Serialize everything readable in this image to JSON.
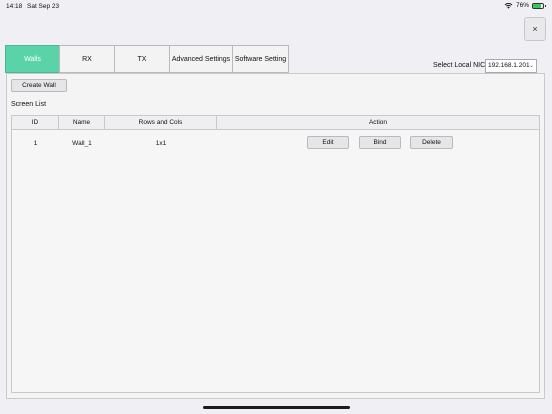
{
  "status_bar": {
    "time": "14:18",
    "date": "Sat Sep 23",
    "battery": "76%",
    "battery_level": 0.76
  },
  "close_button": {
    "label": "×"
  },
  "tabs": [
    {
      "label": "Walls",
      "active": true
    },
    {
      "label": "RX",
      "active": false
    },
    {
      "label": "TX",
      "active": false
    },
    {
      "label": "Advanced Settings",
      "active": false
    },
    {
      "label": "Software Setting",
      "active": false
    }
  ],
  "nic": {
    "label": "Select Local NIC",
    "value": "192.168.1.201"
  },
  "walls": {
    "create_button": "Create Wall",
    "list_label": "Screen List",
    "columns": [
      "ID",
      "Name",
      "Rows and Cols",
      "Action"
    ],
    "rows": [
      {
        "id": "1",
        "name": "Wall_1",
        "rows_cols": "1x1"
      }
    ],
    "actions": [
      "Edit",
      "Bind",
      "Delete"
    ]
  },
  "colors": {
    "active_tab": "#5ad3a8",
    "background": "#efeff4"
  }
}
